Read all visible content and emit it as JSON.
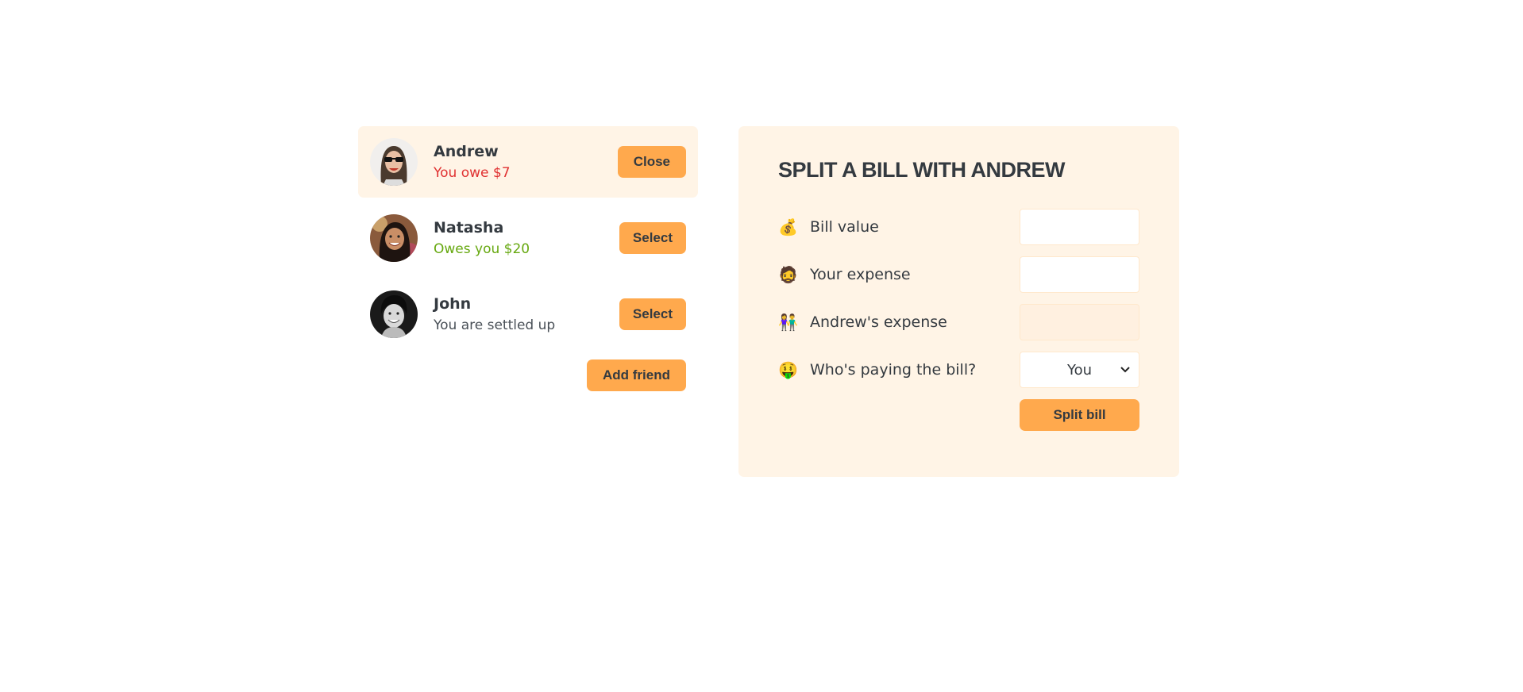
{
  "friends": [
    {
      "name": "Andrew",
      "balance": "You owe $7",
      "button": "Close",
      "selected": true
    },
    {
      "name": "Natasha",
      "balance": "Owes you $20",
      "button": "Select",
      "selected": false
    },
    {
      "name": "John",
      "balance": "You are settled up",
      "button": "Select",
      "selected": false
    }
  ],
  "sidebar": {
    "add_friend_label": "Add friend"
  },
  "form": {
    "title": "SPLIT A BILL WITH ANDREW",
    "bill_value": {
      "emoji": "💰",
      "label": "Bill value",
      "value": ""
    },
    "your_expense": {
      "emoji": "🧔",
      "label": "Your expense",
      "value": ""
    },
    "friend_expense": {
      "emoji": "👫",
      "label": "Andrew's expense",
      "value": ""
    },
    "payer": {
      "emoji": "🤑",
      "label": "Who's paying the bill?",
      "selected": "You"
    },
    "submit_label": "Split bill"
  },
  "colors": {
    "accent": "#ffa94d",
    "panel": "#fff4e6",
    "negative": "#e03131",
    "positive": "#66a80f"
  }
}
